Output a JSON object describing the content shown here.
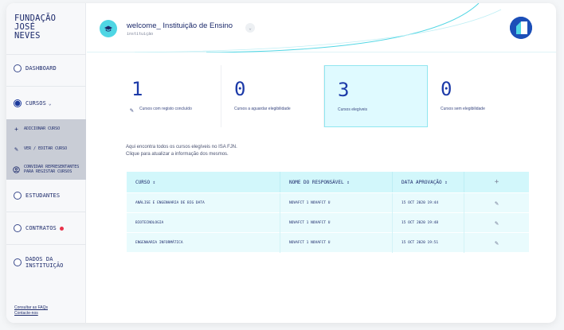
{
  "sidebar": {
    "brand": [
      "FUNDAÇÃO",
      "JOSÉ",
      "NEVES"
    ],
    "items": [
      {
        "label": "DASHBOARD"
      },
      {
        "label": "CURSOS"
      },
      {
        "label": "ESTUDANTES"
      },
      {
        "label": "CONTRATOS"
      },
      {
        "label": "DADOS DA INSTITUIÇÃO"
      }
    ],
    "submenu": [
      {
        "label": "ADICIONAR CURSO",
        "icon": "plus-icon"
      },
      {
        "label": "VER / EDITAR CURSO",
        "icon": "pencil-icon"
      },
      {
        "label": "CONVIDAR REPRESENTANTES PARA REGISTAR CURSOS",
        "icon": "user-circle-icon"
      }
    ],
    "footer": {
      "faqs": "Consultar as FAQs",
      "contact": "Contacte-nos"
    }
  },
  "header": {
    "welcome": "welcome_ Instituição de Ensino",
    "subtitle": "instituição"
  },
  "stats": [
    {
      "value": "1",
      "label": "Cursos com registo concluído"
    },
    {
      "value": "0",
      "label": "Cursos a aguardar elegibilidade"
    },
    {
      "value": "3",
      "label": "Cursos elegíveis"
    },
    {
      "value": "0",
      "label": "Cursos sem elegibilidade"
    }
  ],
  "intro": {
    "line1": "Aqui encontra todos os cursos elegíveis no ISA FJN.",
    "line2": "Clique para atualizar a informação dos mesmos."
  },
  "table": {
    "headers": [
      "CURSO ⇕",
      "NOME DO RESPONSÁVEL ⇕",
      "DATA APROVAÇÃO ⇕",
      "+"
    ],
    "rows": [
      {
        "curso": "ANÁLISE E ENGENHARIA DE BIG DATA",
        "responsavel": "NOVAFCT 1 NOVAFCT U",
        "data": "15 OCT 2020 19:44"
      },
      {
        "curso": "BIOTECNOLOGIA",
        "responsavel": "NOVAFCT 1 NOVAFCT U",
        "data": "15 OCT 2020 19:48"
      },
      {
        "curso": "ENGENHARIA INFORMÁTICA",
        "responsavel": "NOVAFCT 1 NOVAFCT U",
        "data": "15 OCT 2020 19:51"
      }
    ]
  },
  "colors": {
    "accent": "#1c3aa8",
    "cyan": "#4fd6e4",
    "alert": "#e8324a"
  }
}
